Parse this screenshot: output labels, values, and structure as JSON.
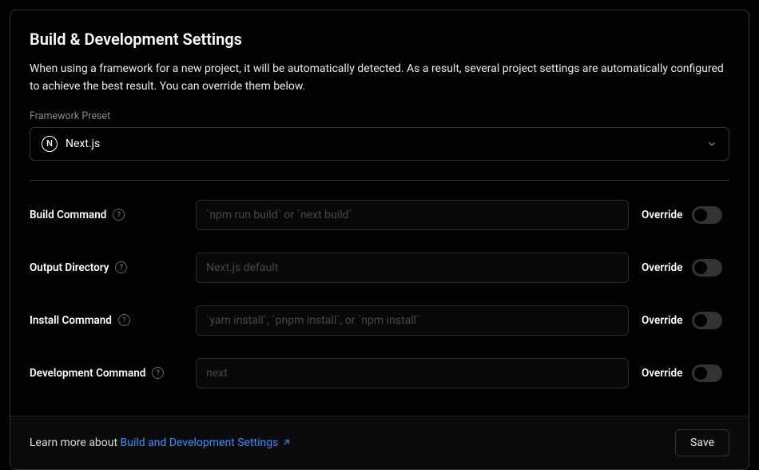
{
  "title": "Build & Development Settings",
  "description": "When using a framework for a new project, it will be automatically detected. As a result, several project settings are automatically configured to achieve the best result. You can override them below.",
  "framework": {
    "label": "Framework Preset",
    "selected": "Next.js",
    "iconLetter": "N"
  },
  "rows": {
    "build": {
      "label": "Build Command",
      "placeholder": "`npm run build` or `next build`",
      "override": "Override"
    },
    "output": {
      "label": "Output Directory",
      "placeholder": "Next.js default",
      "override": "Override"
    },
    "install": {
      "label": "Install Command",
      "placeholder": "`yarn install`, `pnpm install`, or `npm install`",
      "override": "Override"
    },
    "dev": {
      "label": "Development Command",
      "placeholder": "next",
      "override": "Override"
    }
  },
  "footer": {
    "learnPrefix": "Learn more about ",
    "learnLink": "Build and Development Settings",
    "save": "Save"
  },
  "help": "?"
}
